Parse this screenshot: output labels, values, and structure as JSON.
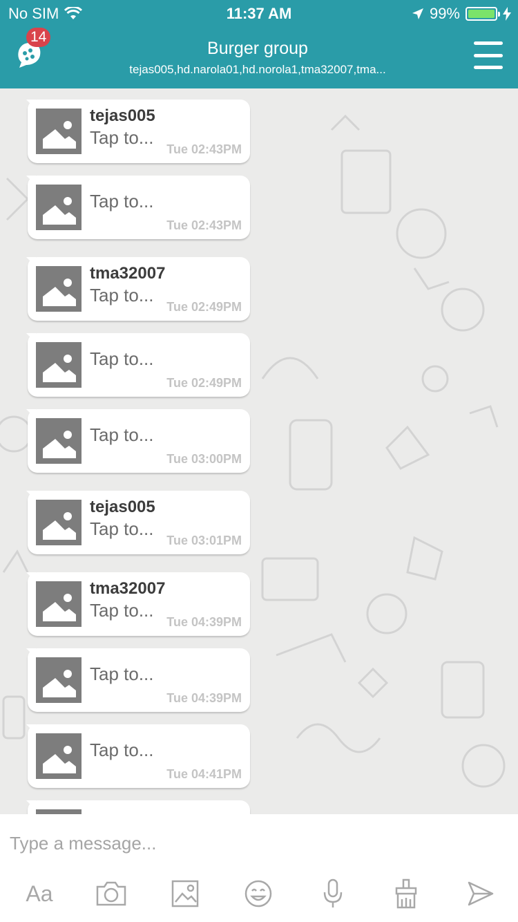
{
  "status_bar": {
    "carrier": "No SIM",
    "time": "11:37 AM",
    "battery_text": "99%",
    "battery_level": 0.99
  },
  "header": {
    "badge_count": "14",
    "title": "Burger group",
    "subtitle": "tejas005,hd.narola01,hd.norola1,tma32007,tma...",
    "bg_color": "#2a9ca8"
  },
  "messages": [
    {
      "sender": "tejas005",
      "caption": "Tap to...",
      "time": "Tue 02:43PM"
    },
    {
      "sender": "",
      "caption": "Tap to...",
      "time": "Tue 02:43PM"
    },
    {
      "sender": "tma32007",
      "caption": "Tap to...",
      "time": "Tue 02:49PM"
    },
    {
      "sender": "",
      "caption": "Tap to...",
      "time": "Tue 02:49PM"
    },
    {
      "sender": "",
      "caption": "Tap to...",
      "time": "Tue 03:00PM"
    },
    {
      "sender": "tejas005",
      "caption": "Tap to...",
      "time": "Tue 03:01PM"
    },
    {
      "sender": "tma32007",
      "caption": "Tap to...",
      "time": "Tue 04:39PM"
    },
    {
      "sender": "",
      "caption": "Tap to...",
      "time": "Tue 04:39PM"
    },
    {
      "sender": "",
      "caption": "Tap to...",
      "time": "Tue 04:41PM"
    }
  ],
  "composer": {
    "placeholder": "Type a message...",
    "font_button": "Aa",
    "tools": [
      "font-icon",
      "camera-icon",
      "gallery-icon",
      "emoji-icon",
      "microphone-icon",
      "brush-icon",
      "send-icon"
    ]
  }
}
